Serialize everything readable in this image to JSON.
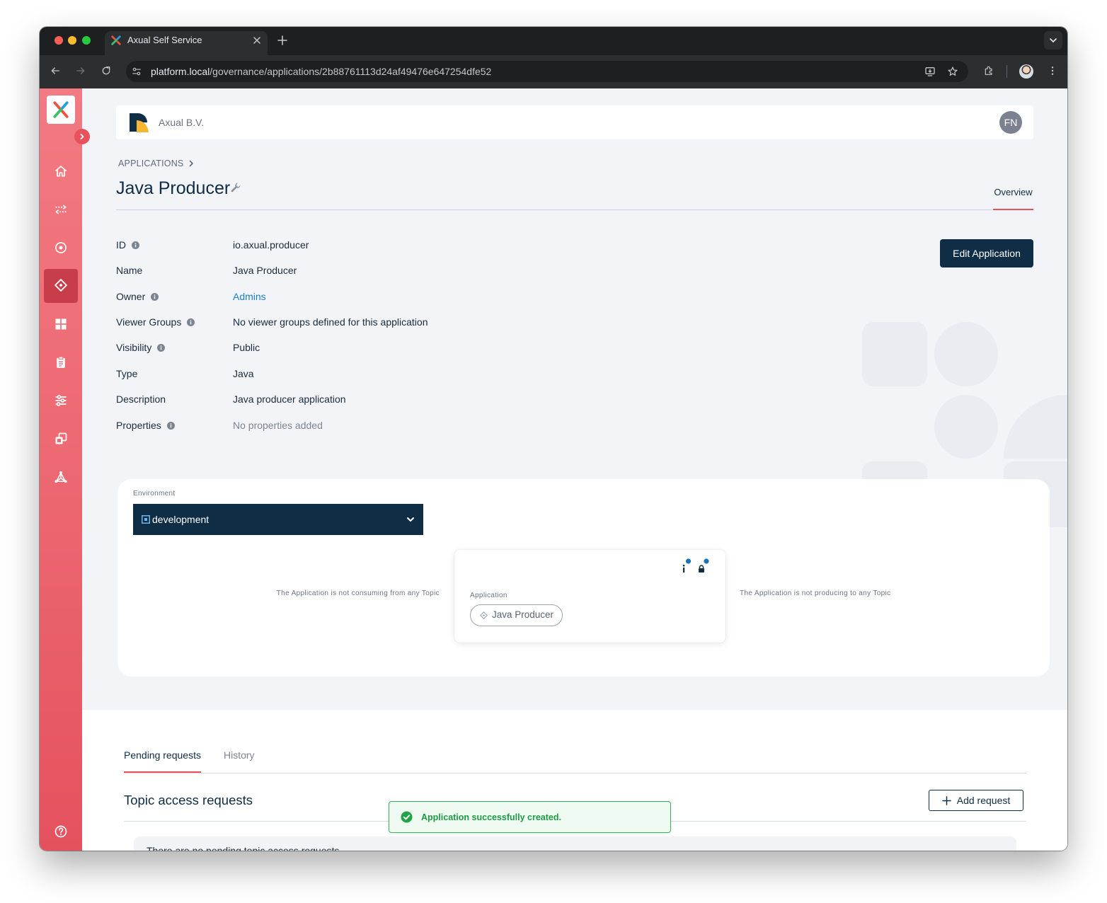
{
  "browser": {
    "tab_title": "Axual Self Service",
    "url_host": "platform.local",
    "url_path": "/governance/applications/2b88761113d24af49476e647254dfe52"
  },
  "sidebar": {
    "icons": [
      "home-icon",
      "streams-icon",
      "target-icon",
      "applications-icon",
      "dashboard-icon",
      "clipboard-icon",
      "sliders-icon",
      "copy-icon",
      "topology-icon",
      "help-icon"
    ],
    "active_index": 3
  },
  "header": {
    "org_name": "Axual B.V.",
    "avatar_initials": "FN"
  },
  "breadcrumb": {
    "applications": "APPLICATIONS"
  },
  "page": {
    "title": "Java Producer",
    "overview_tab": "Overview",
    "edit_button": "Edit Application"
  },
  "details": [
    {
      "label": "ID",
      "value": "io.axual.producer"
    },
    {
      "label": "Name",
      "value": "Java Producer"
    },
    {
      "label": "Owner",
      "value": "Admins"
    },
    {
      "label": "Viewer Groups",
      "value": "No viewer groups defined for this application"
    },
    {
      "label": "Visibility",
      "value": "Public"
    },
    {
      "label": "Type",
      "value": "Java"
    },
    {
      "label": "Description",
      "value": "Java producer application"
    },
    {
      "label": "Properties",
      "value": "No properties added"
    }
  ],
  "environment": {
    "label": "Environment",
    "selected": "development"
  },
  "topology": {
    "consuming_text": "The Application is not consuming from any Topic",
    "producing_text": "The Application is not producing to any Topic",
    "app_label": "Application",
    "app_chip": "Java Producer"
  },
  "requests": {
    "tab_pending": "Pending requests",
    "tab_history": "History",
    "title": "Topic access requests",
    "add_button": "Add request",
    "empty_text": "There are no pending topic access requests"
  },
  "toast": {
    "message": "Application successfully created."
  },
  "colors": {
    "sidebar_top": "#f27a82",
    "sidebar_bottom": "#e4525e",
    "navy": "#0f2d44",
    "accent": "#e8525c",
    "link": "#1a7fc1",
    "success": "#22a34a"
  }
}
